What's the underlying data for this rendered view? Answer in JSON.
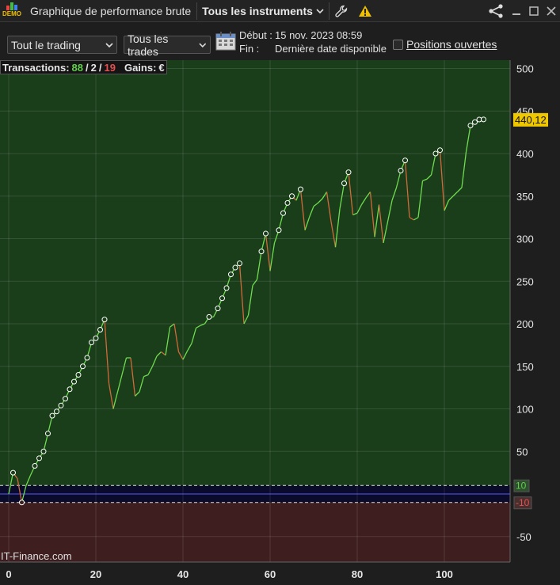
{
  "titlebar": {
    "logo_text": "DEMO",
    "title": "Graphique de performance brute",
    "instrument": "Tous les instruments",
    "wrench_icon": "wrench-icon",
    "warning_icon": "warning-icon",
    "share_icon": "share-icon",
    "minimize_icon": "minimize-icon",
    "maximize_icon": "maximize-icon",
    "close_icon": "close-icon"
  },
  "toolbar": {
    "trading_select": "Tout le trading",
    "trades_select": "Tous les trades",
    "calendar_icon": "calendar-icon",
    "start_label": "Début :",
    "start_value": "15 nov. 2023 08:59",
    "end_label": "Fin :",
    "end_value": "Dernière date disponible",
    "open_positions_label": "Positions ouvertes"
  },
  "stats": {
    "transactions_label": "Transactions:",
    "wins": "88",
    "slash1": "/",
    "neutral": "2",
    "slash2": "/",
    "losses": "19",
    "gains_label": "Gains:",
    "currency": "€"
  },
  "watermark": "IT-Finance.com",
  "colors": {
    "profit_zone": "#1a3d1a",
    "loss_zone": "#3e1e1e",
    "up_line": "#6fdc50",
    "down_line": "#d06a3a",
    "last_value_bg": "#f0c800",
    "threshold_line": "#dddddd"
  },
  "chart_data": {
    "type": "line",
    "xlabel": "",
    "ylabel": "",
    "xlim": [
      0,
      115
    ],
    "ylim": [
      -80,
      510
    ],
    "x_ticks": [
      "0",
      "20",
      "40",
      "60",
      "80",
      "100"
    ],
    "y_ticks": [
      "500",
      "450",
      "400",
      "350",
      "300",
      "250",
      "200",
      "150",
      "100",
      "50",
      "-50"
    ],
    "last_value_label": "440,12",
    "upper_threshold": 10,
    "upper_threshold_label": "10",
    "lower_threshold": -10,
    "lower_threshold_label": "-10",
    "series": [
      {
        "x": [
          0,
          1,
          2,
          3,
          4,
          5,
          6,
          7,
          8,
          9,
          10,
          11,
          12,
          13,
          14,
          15,
          16,
          17,
          18,
          19,
          20,
          21,
          22,
          23,
          24,
          25,
          26,
          27,
          28,
          29,
          30,
          31,
          32,
          33,
          34,
          35,
          36,
          37,
          38,
          39,
          40,
          41,
          42,
          43,
          44,
          45,
          46,
          47,
          48,
          49,
          50,
          51,
          52,
          53,
          54,
          55,
          56,
          57,
          58,
          59,
          60,
          61,
          62,
          63,
          64,
          65,
          66,
          67,
          68,
          69,
          70,
          71,
          72,
          73,
          74,
          75,
          76,
          77,
          78,
          79,
          80,
          81,
          82,
          83,
          84,
          85,
          86,
          87,
          88,
          89,
          90,
          91,
          92,
          93,
          94,
          95,
          96,
          97,
          98,
          99,
          100,
          101,
          102,
          103,
          104,
          105,
          106,
          107,
          108,
          109
        ],
        "y": [
          0,
          25,
          18,
          -10,
          10,
          22,
          33,
          42,
          50,
          71,
          92,
          97,
          104,
          112,
          123,
          132,
          140,
          150,
          160,
          178,
          183,
          193,
          205,
          130,
          100,
          120,
          140,
          160,
          160,
          115,
          120,
          138,
          140,
          150,
          162,
          167,
          163,
          196,
          200,
          167,
          158,
          168,
          177,
          195,
          198,
          200,
          208,
          208,
          218,
          230,
          242,
          258,
          266,
          271,
          200,
          210,
          245,
          252,
          285,
          306,
          262,
          295,
          310,
          330,
          342,
          350,
          345,
          358,
          310,
          325,
          338,
          342,
          347,
          355,
          320,
          290,
          335,
          365,
          378,
          328,
          330,
          340,
          348,
          355,
          302,
          340,
          295,
          320,
          345,
          360,
          380,
          392,
          325,
          322,
          325,
          368,
          370,
          375,
          400,
          404,
          333,
          345,
          350,
          355,
          360,
          402,
          433,
          437,
          440,
          440.12
        ]
      }
    ]
  }
}
